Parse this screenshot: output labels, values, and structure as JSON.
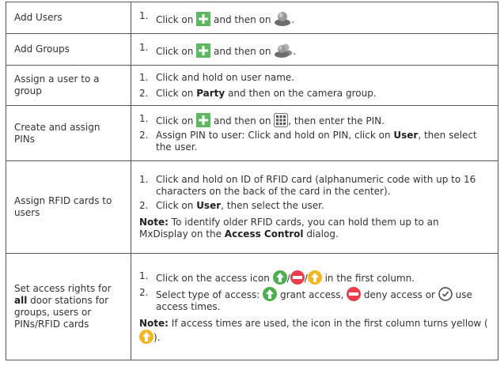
{
  "rows": [
    {
      "task": "Add Users",
      "steps": [
        {
          "num": "1.",
          "a": "Click on",
          "b": "and then on",
          "c": "."
        }
      ]
    },
    {
      "task": "Add Groups",
      "steps": [
        {
          "num": "1.",
          "a": "Click on",
          "b": "and then on",
          "c": "."
        }
      ]
    },
    {
      "task": "Assign a user to a group",
      "steps": [
        {
          "num": "1.",
          "text": "Click and hold on user name."
        },
        {
          "num": "2.",
          "a": "Click on",
          "bold": "Party",
          "c": "and then on the camera group."
        }
      ]
    },
    {
      "task": "Create and assign PINs",
      "steps": [
        {
          "num": "1.",
          "a": "Click on",
          "b": "and then on",
          "c": ", then enter the PIN."
        },
        {
          "num": "2.",
          "a": "Assign PIN to user: Click and hold on PIN, click on",
          "bold": "User",
          "c": ", then select the user."
        }
      ]
    },
    {
      "task": "Assign RFID cards to users",
      "steps": [
        {
          "num": "1.",
          "text": "Click and hold on ID of RFID card (alphanumeric code with up to 16 characters on the back of the card in the center)."
        },
        {
          "num": "2.",
          "a": "Click on",
          "bold": "User",
          "c": ", then select the user."
        }
      ],
      "note": {
        "label": "Note:",
        "a": "To identify older RFID cards, you can hold them up to an MxDisplay on the",
        "bold": "Access Control",
        "c": "dialog."
      }
    },
    {
      "task_a": "Set access rights for",
      "task_bold": "all",
      "task_c": "door stations for groups, users or PINs/RFID cards",
      "steps": [
        {
          "num": "1.",
          "a": "Click on the access icon",
          "sep1": "/",
          "sep2": "/",
          "c": "in the first column."
        },
        {
          "num": "2.",
          "a": "Select type of access:",
          "grant": "grant access,",
          "deny": "deny access or",
          "times": "use access times."
        }
      ],
      "note": {
        "label": "Note:",
        "a": "If access times are used, the icon in the first column turns yellow (",
        "c": ")."
      }
    }
  ],
  "icons": {
    "plus_color": "#5cb85c",
    "grant_color": "#4cae4c",
    "deny_color": "#e8404a",
    "yellow_color": "#f5b51e"
  }
}
